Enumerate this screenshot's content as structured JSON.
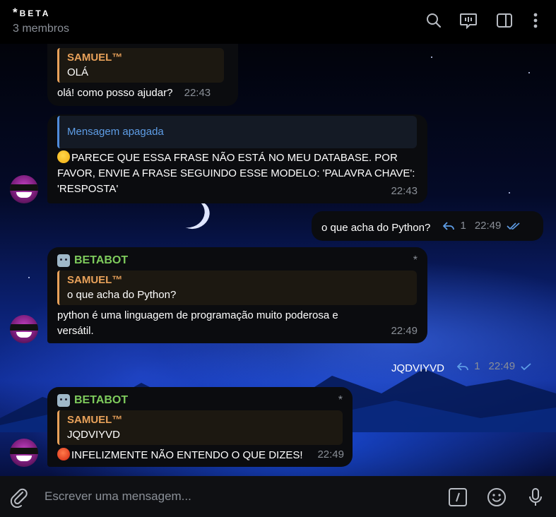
{
  "header": {
    "title": "BETA",
    "subtitle": "3 membros",
    "icons": [
      "search-icon",
      "video-chat-icon",
      "sidebar-icon",
      "more-icon"
    ]
  },
  "messages": [
    {
      "reply_name": "SAMUEL™",
      "reply_text": "OLÁ",
      "text": "olá! como posso ajudar?",
      "time": "22:43"
    },
    {
      "reply_text": "Mensagem apagada",
      "text_line1": "PARECE QUE ESSA FRASE NÃO ESTÁ NO MEU DATABASE. POR",
      "text_line2": "FAVOR, ENVIE A FRASE SEGUINDO ESSE MODELO: 'PALAVRA CHAVE':",
      "text_line3": "'RESPOSTA'",
      "emoji": "thinking-face",
      "time": "22:43"
    },
    {
      "outgoing": true,
      "text": "o que acha do Python?",
      "reply_count": "1",
      "time": "22:49",
      "status": "read"
    },
    {
      "sender": "BETABOT",
      "star": "*",
      "reply_name": "SAMUEL™",
      "reply_text": "o que acha do Python?",
      "text_line1": "python é uma linguagem de programação muito poderosa e",
      "text_line2": "versátil.",
      "time": "22:49"
    },
    {
      "outgoing": true,
      "text": "JQDVIYVD",
      "reply_count": "1",
      "time": "22:49",
      "status": "sent"
    },
    {
      "sender": "BETABOT",
      "star": "*",
      "reply_name": "SAMUEL™",
      "reply_text": "JQDVIYVD",
      "text": "INFELIZMENTE NÃO ENTENDO O QUE DIZES!",
      "emoji": "angry-face",
      "time": "22:49"
    }
  ],
  "composer": {
    "placeholder": "Escrever uma mensagem...",
    "icons": [
      "attach-icon",
      "commands-icon",
      "emoji-icon",
      "microphone-icon"
    ]
  },
  "colors": {
    "accent_name": "#e8a15a",
    "bot_name": "#7ecb5c",
    "deleted_link": "#5e9de6",
    "check_blue": "#5e9de6"
  }
}
